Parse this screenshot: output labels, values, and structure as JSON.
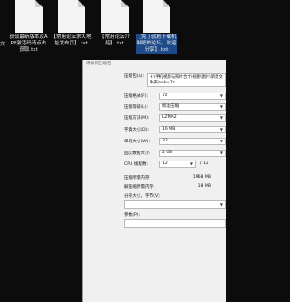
{
  "desktop": {
    "left_edge_label": "文",
    "files": [
      {
        "label": "获取最新版本及APP激活码请点击获取.txt"
      },
      {
        "label": "【常用论坛求久地址发布页】.txt"
      },
      {
        "label": "【常用论坛介绍】.txt"
      },
      {
        "label": "【免了就刷下载机制吧的论坛。欢迎分享】.txt"
      }
    ]
  },
  "dialog": {
    "title": "添加到压缩包",
    "archive_label": "压缩包(A):",
    "archive_path": "H:\\手机视频与照片合计\\视频\\图片\\新建文件夹\\bahu.7z",
    "format_label": "压缩格式(F):",
    "format_value": "7z",
    "level_label": "压缩等级(L):",
    "level_value": "标准压缩",
    "method_label": "压缩方法(M):",
    "method_value": "LZMA2",
    "dict_label": "字典大小(D):",
    "dict_value": "16 MB",
    "word_label": "单词大小(W):",
    "word_value": "32",
    "solid_label": "固实数据大小:",
    "solid_value": "2 GB",
    "cpu_label": "CPU 线程数:",
    "cpu_value": "12",
    "cpu_max": "/ 12",
    "mem_comp_label": "压缩所需内存:",
    "mem_comp_value": "1968 MB",
    "mem_decomp_label": "解压缩所需内存:",
    "mem_decomp_value": "18 MB",
    "split_label": "分卷大小，字节(V):",
    "params_label": "参数(P):"
  }
}
